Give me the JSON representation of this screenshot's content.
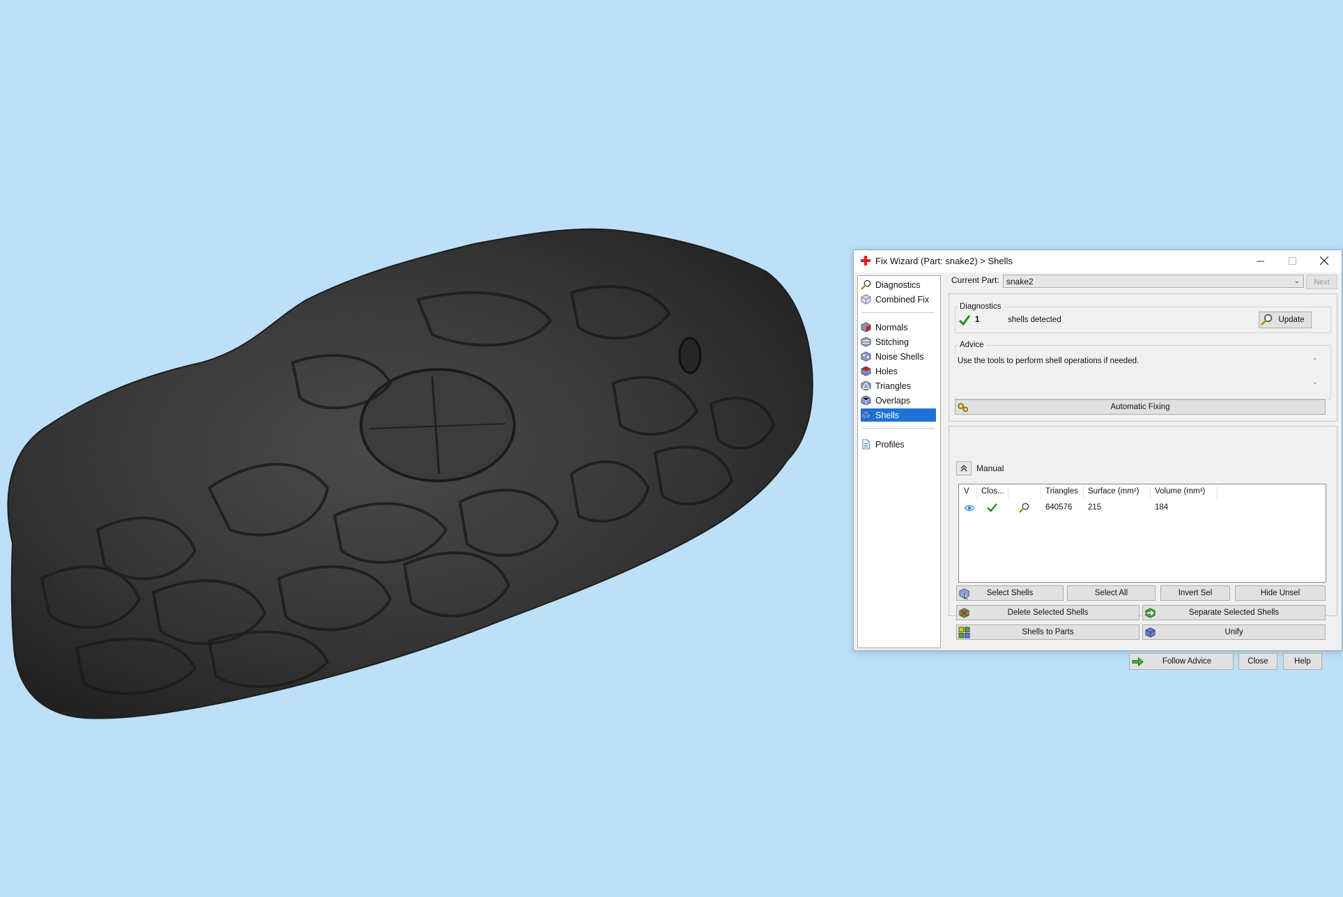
{
  "window": {
    "title": "Fix Wizard (Part: snake2) > Shells"
  },
  "nav": {
    "items_top": [
      {
        "label": "Diagnostics",
        "icon": "magnifier-icon"
      },
      {
        "label": "Combined Fix",
        "icon": "cube-icon"
      }
    ],
    "items_fix": [
      {
        "label": "Normals",
        "icon": "normals-cube-icon"
      },
      {
        "label": "Stitching",
        "icon": "stitching-cube-icon"
      },
      {
        "label": "Noise Shells",
        "icon": "noise-shells-icon"
      },
      {
        "label": "Holes",
        "icon": "holes-cube-icon"
      },
      {
        "label": "Triangles",
        "icon": "triangles-cube-icon"
      },
      {
        "label": "Overlaps",
        "icon": "overlaps-cube-icon"
      },
      {
        "label": "Shells",
        "icon": "shells-cube-icon",
        "active": true
      }
    ],
    "items_bottom": [
      {
        "label": "Profiles",
        "icon": "document-icon"
      }
    ]
  },
  "part": {
    "label": "Current Part:",
    "value": "snake2",
    "next_label": "Next"
  },
  "diagnostics": {
    "group_label": "Diagnostics",
    "count": "1",
    "text": "shells detected",
    "update_label": "Update"
  },
  "advice": {
    "group_label": "Advice",
    "text": "Use the tools to perform shell operations if needed.",
    "automatic_fixing_label": "Automatic Fixing"
  },
  "manual": {
    "label": "Manual",
    "columns": [
      "V",
      "Clos...",
      "",
      "Triangles",
      "Surface (mm²)",
      "Volume (mm³)"
    ],
    "rows": [
      {
        "visible": "eye-icon",
        "closed": "check-icon",
        "detail": "magnifier-icon",
        "triangles": "640576",
        "surface": "215",
        "volume": "184"
      }
    ],
    "buttons": {
      "select_shells": "Select Shells",
      "select_all": "Select All",
      "invert_sel": "Invert Sel",
      "hide_unsel": "Hide Unsel",
      "delete_selected": "Delete Selected Shells",
      "separate_selected": "Separate Selected Shells",
      "shells_to_parts": "Shells to Parts",
      "unify": "Unify"
    }
  },
  "footer": {
    "follow_advice": "Follow Advice",
    "close": "Close",
    "help": "Help"
  },
  "colors": {
    "background": "#bde0f8",
    "model": "#2e2e2e",
    "nav_active": "#1e73d6",
    "check_green": "#1f8a1f"
  }
}
